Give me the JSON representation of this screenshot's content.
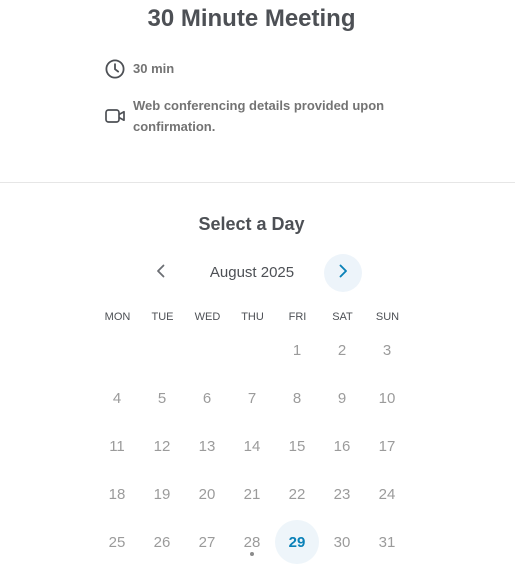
{
  "event": {
    "title": "30 Minute Meeting",
    "duration_icon": "clock-icon",
    "duration": "30 min",
    "location_icon": "video-camera-icon",
    "location": "Web conferencing details provided upon confirmation."
  },
  "calendar": {
    "heading": "Select a Day",
    "month_label": "August 2025",
    "prev_icon": "chevron-left-icon",
    "next_icon": "chevron-right-icon",
    "weekdays": [
      "MON",
      "TUE",
      "WED",
      "THU",
      "FRI",
      "SAT",
      "SUN"
    ],
    "first_weekday_index": 4,
    "days_in_month": 31,
    "available_days": [
      29
    ],
    "today": 28,
    "colors": {
      "accent": "#0a81b8",
      "available_bg": "#eef5fa",
      "muted_day": "#9b9b9b"
    }
  }
}
